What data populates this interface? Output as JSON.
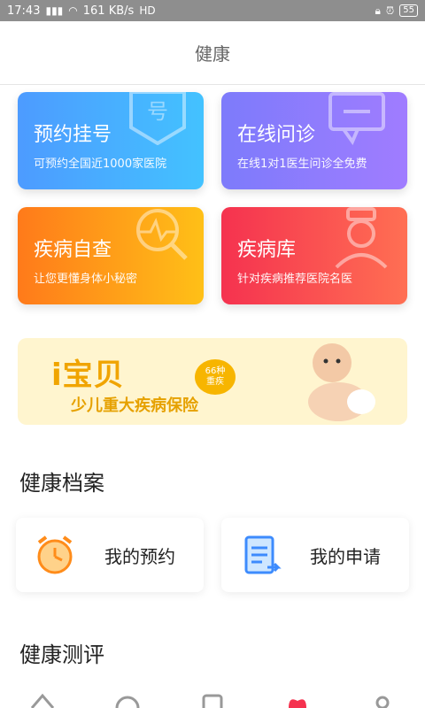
{
  "statusbar": {
    "time": "17:43",
    "signal": "4G",
    "speed": "161 KB/s",
    "hd": "HD",
    "battery": "55"
  },
  "header": {
    "title": "健康"
  },
  "cards": [
    {
      "title": "预约挂号",
      "subtitle": "可预约全国近1000家医院",
      "icon": "ticket-icon"
    },
    {
      "title": "在线问诊",
      "subtitle": "在线1对1医生问诊全免费",
      "icon": "chat-icon"
    },
    {
      "title": "疾病自查",
      "subtitle": "让您更懂身体小秘密",
      "icon": "search-pulse-icon"
    },
    {
      "title": "疾病库",
      "subtitle": "针对疾病推荐医院名医",
      "icon": "doctor-icon"
    }
  ],
  "banner": {
    "headline": "i宝贝",
    "badge_top": "66种",
    "badge_bottom": "重疾",
    "subtitle": "少儿重大疾病保险"
  },
  "sections": {
    "records": "健康档案",
    "assessment": "健康测评"
  },
  "records": [
    {
      "label": "我的预约",
      "icon": "alarm-clock-icon"
    },
    {
      "label": "我的申请",
      "icon": "document-icon"
    }
  ],
  "colors": {
    "blue": "#4d9bff",
    "purple": "#7d7bfb",
    "orange": "#ff7a1a",
    "red": "#f5324f",
    "banner": "#fff5cf"
  }
}
